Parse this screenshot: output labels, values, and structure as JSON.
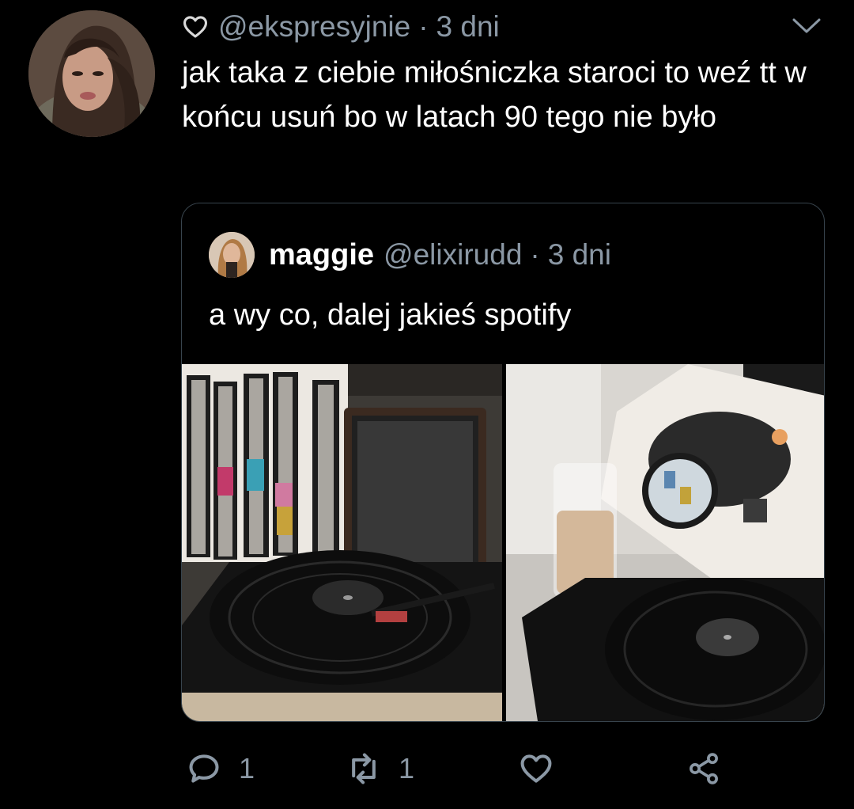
{
  "tweet": {
    "handle": "@ekspresyjnie",
    "separator": "·",
    "time": "3 dni",
    "text": "jak taka z ciebie miłośniczka staroci to weź tt w końcu usuń bo w latach 90 tego nie było"
  },
  "quoted": {
    "name": "maggie",
    "handle": "@elixirudd",
    "separator": "·",
    "time": "3 dni",
    "text": "a wy co, dalej jakieś spotify"
  },
  "actions": {
    "reply_count": "1",
    "retweet_count": "1"
  },
  "icons": [
    "heart-small-icon",
    "chevron-down-icon",
    "reply-icon",
    "retweet-icon",
    "like-icon",
    "share-icon"
  ],
  "colors": {
    "background": "#000000",
    "text": "#ffffff",
    "secondary": "#8b98a5",
    "border": "#38444d"
  }
}
